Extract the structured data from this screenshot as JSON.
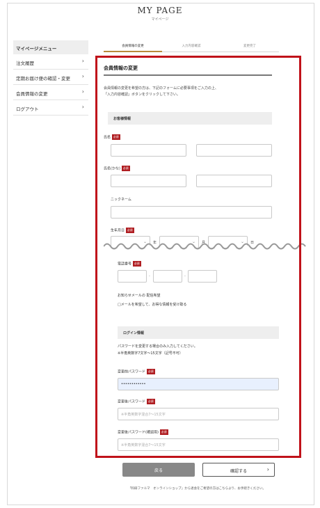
{
  "header": {
    "title": "MY PAGE",
    "subtitle": "マイページ"
  },
  "sidebar": {
    "heading": "マイページメニュー",
    "items": [
      {
        "label": "注文履歴"
      },
      {
        "label": "定期お届け便の確認・変更"
      },
      {
        "label": "会員情報の変更"
      },
      {
        "label": "ログアウト"
      }
    ],
    "chevron": "›"
  },
  "steps": [
    {
      "label": "会員情報の変更",
      "active": true
    },
    {
      "label": "入力内容確認",
      "active": false
    },
    {
      "label": "変更完了",
      "active": false
    }
  ],
  "form": {
    "title": "会員情報の変更",
    "intro_line1": "会員情報の変更を希望の方は、下記のフォームに必要事項をご入力の上、",
    "intro_line2": "「入力内容確認」ボタンをクリックして下さい。",
    "customer_section": "お客様情報",
    "required_badge": "必須",
    "name_label": "氏名",
    "kana_label": "氏名(かな)",
    "nickname_label": "ニックネーム",
    "birthday_label": "生年月日",
    "year_unit": "年",
    "month_unit": "月",
    "day_unit": "日",
    "phone_label": "電話番号",
    "phone_sep": "-",
    "newsletter_label": "お知らせメールの 配信希望",
    "newsletter_option": "□メールを希望して、お得な情報を受け取る",
    "login_section": "ログイン情報",
    "password_note1": "パスワードを変更する場合のみ入力してください。",
    "password_note2": "※半角英数字7文字～15文字（記号不可）",
    "current_password_label": "変更前パスワード",
    "current_password_value": "••••••••••••",
    "new_password_label": "変更後パスワード",
    "new_password_placeholder": "※半角英数字混合7～15文字",
    "confirm_password_label": "変更後パスワード(確認用)",
    "confirm_password_placeholder": "※半角英数字混合7～15文字"
  },
  "buttons": {
    "back": "戻る",
    "confirm": "確認する",
    "confirm_chevron": "›"
  },
  "footer_note": "「料研ファルマ　オンラインショップ」から退会をご希望の方はこちらより、お手続きください。",
  "colors": {
    "highlight": "#c0121a",
    "required": "#b01e22",
    "step_active": "#b88a3a"
  }
}
